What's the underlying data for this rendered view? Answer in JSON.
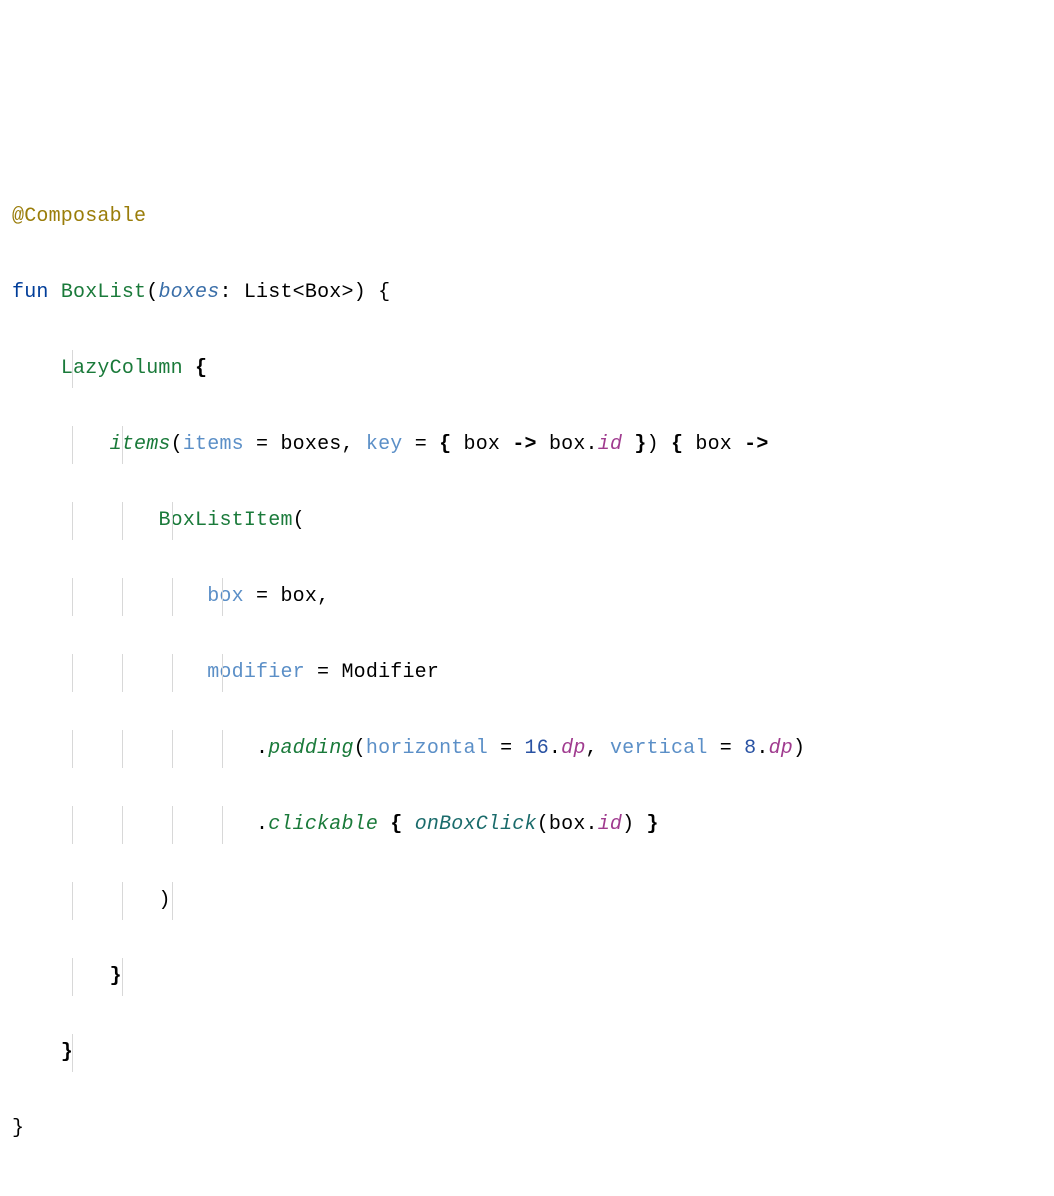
{
  "code": {
    "line0": {
      "annotation": "@Composable"
    },
    "line1": {
      "kw_fun": "fun",
      "func": "BoxList",
      "lparen": "(",
      "param_boxes": "boxes",
      "colon": ": ",
      "type": "List<Box>",
      "rparen_brace": ") {"
    },
    "line2": {
      "call": "LazyColumn",
      "space": " ",
      "brace": "{"
    },
    "line3": {
      "call": "items",
      "lparen": "(",
      "p1": "items",
      "eq1": " = ",
      "v1": "boxes",
      "sep1": ", ",
      "p2": "key",
      "eq2": " = ",
      "lam_open": "{ ",
      "lam_param": "box",
      "arrow": " -> ",
      "lam_body1": "box.",
      "lam_body2": "id",
      "lam_close": " }",
      "rparen": ") ",
      "trail_open": "{ ",
      "trail_param": "box",
      "trail_arrow": " ->"
    },
    "line4": {
      "call": "BoxListItem",
      "lparen": "("
    },
    "line5": {
      "p": "box",
      "eq": " = ",
      "v": "box",
      "comma": ","
    },
    "line6": {
      "p": "modifier",
      "eq": " = ",
      "v": "Modifier"
    },
    "line7": {
      "dot": ".",
      "call": "padding",
      "lparen": "(",
      "p1": "horizontal",
      "eq1": " = ",
      "n1": "16",
      "dot1": ".",
      "u1": "dp",
      "sep": ", ",
      "p2": "vertical",
      "eq2": " = ",
      "n2": "8",
      "dot2": ".",
      "u2": "dp",
      "rparen": ")"
    },
    "line8": {
      "dot": ".",
      "call": "clickable",
      "space": " ",
      "lb": "{ ",
      "inner": "onBoxClick",
      "lparen": "(",
      "arg1": "box.",
      "arg2": "id",
      "rparen": ")",
      "rb": " }"
    },
    "line9": {
      "rparen": ")"
    },
    "line10": {
      "brace": "}"
    },
    "line11": {
      "brace": "}"
    },
    "line12": {
      "brace": "}"
    }
  },
  "indent": {
    "i1": "    ",
    "i2": "        ",
    "i3": "            ",
    "i4": "                ",
    "i5": "                    "
  }
}
